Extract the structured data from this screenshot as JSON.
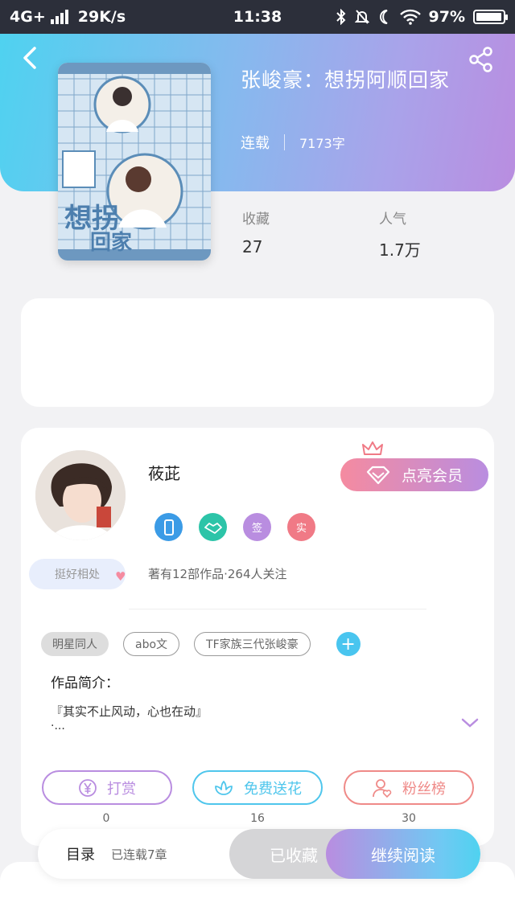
{
  "status_bar": {
    "network": "4G+",
    "speed": "29K/s",
    "time": "11:38",
    "battery": "97%",
    "battery_level": 0.97
  },
  "book": {
    "title": "张峻豪：想拐阿顺回家",
    "status": "连载",
    "word_count": "7173字"
  },
  "stats": {
    "favorites_label": "收藏",
    "favorites_value": "27",
    "popularity_label": "人气",
    "popularity_value": "1.7万"
  },
  "author": {
    "name": "莜茈",
    "vip_label": "点亮会员",
    "badges": [
      {
        "icon": "phone-badge-icon",
        "text": "",
        "color": "#3b9be6"
      },
      {
        "icon": "handshake-badge-icon",
        "text": "",
        "color": "#2cc4a8"
      },
      {
        "icon": "sign-badge-icon",
        "text": "签",
        "color": "#b98de0"
      },
      {
        "icon": "real-name-badge-icon",
        "text": "实",
        "color": "#f07a86"
      }
    ],
    "works_info": "著有12部作品·264人关注",
    "tag": "挺好相处"
  },
  "tags": {
    "filled": "明星同人",
    "outline": [
      "abo文",
      "TF家族三代张峻豪"
    ]
  },
  "intro": {
    "title": "作品简介：",
    "text": "『其实不止风动，心也在动』",
    "more": "·..."
  },
  "actions": [
    {
      "label": "打赏",
      "count": "0",
      "color": "#b98de0",
      "icon": "yen-icon"
    },
    {
      "label": "免费送花",
      "count": "16",
      "color": "#4fc6ec",
      "icon": "flower-icon"
    },
    {
      "label": "粉丝榜",
      "count": "30",
      "color": "#ef8a88",
      "icon": "fans-icon"
    }
  ],
  "bottom": {
    "toc_label": "目录",
    "chapters": "已连载7章",
    "collected": "已收藏",
    "continue": "继续阅读"
  }
}
